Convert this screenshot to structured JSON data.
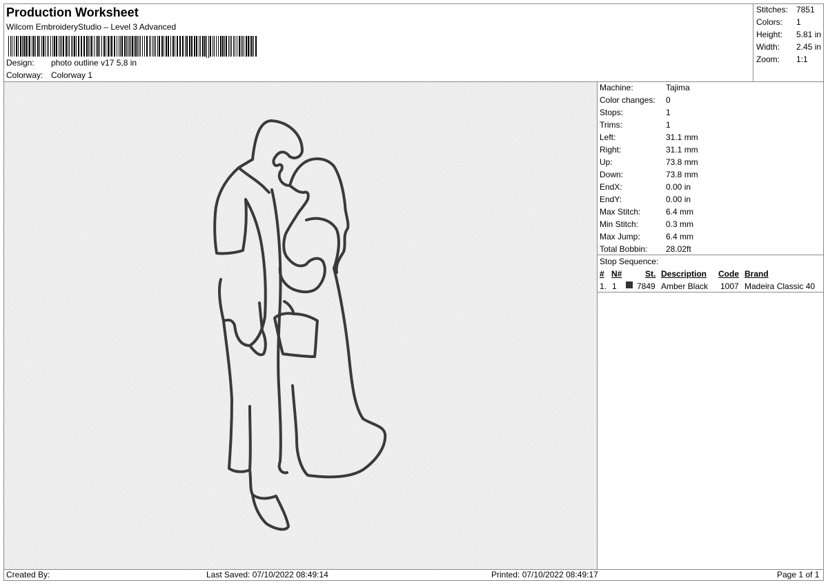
{
  "header": {
    "title": "Production Worksheet",
    "software": "Wilcom EmbroideryStudio – Level 3 Advanced",
    "design_label": "Design:",
    "design_value": "photo outline v17 5,8 in",
    "colorway_label": "Colorway:",
    "colorway_value": "Colorway 1"
  },
  "summary": [
    {
      "label": "Stitches:",
      "value": "7851"
    },
    {
      "label": "Colors:",
      "value": "1"
    },
    {
      "label": "Height:",
      "value": "5.81 in"
    },
    {
      "label": "Width:",
      "value": "2.45 in"
    },
    {
      "label": "Zoom:",
      "value": "1:1"
    }
  ],
  "properties": [
    {
      "label": "Machine:",
      "value": "Tajima"
    },
    {
      "label": "Color changes:",
      "value": "0"
    },
    {
      "label": "Stops:",
      "value": "1"
    },
    {
      "label": "Trims:",
      "value": "1"
    },
    {
      "label": "Left:",
      "value": "31.1 mm"
    },
    {
      "label": "Right:",
      "value": "31.1 mm"
    },
    {
      "label": "Up:",
      "value": "73.8 mm"
    },
    {
      "label": "Down:",
      "value": "73.8 mm"
    },
    {
      "label": "EndX:",
      "value": "0.00 in"
    },
    {
      "label": "EndY:",
      "value": "0.00 in"
    },
    {
      "label": "Max Stitch:",
      "value": "6.4 mm"
    },
    {
      "label": "Min Stitch:",
      "value": "0.3 mm"
    },
    {
      "label": "Max Jump:",
      "value": "6.4 mm"
    },
    {
      "label": "Total Bobbin:",
      "value": "28.02ft"
    }
  ],
  "stop_sequence": {
    "title": "Stop Sequence:",
    "headers": {
      "num": "#",
      "n": "N#",
      "st": "St.",
      "description": "Description",
      "code": "Code",
      "brand": "Brand"
    },
    "rows": [
      {
        "num": "1.",
        "n": "1",
        "color": "#333333",
        "st": "7849",
        "description": "Amber Black",
        "code": "1007",
        "brand": "Madeira Classic 40"
      }
    ]
  },
  "footer": {
    "created_by": "Created By:",
    "last_saved": "Last Saved: 07/10/2022 08:49:14",
    "printed": "Printed: 07/10/2022 08:49:17",
    "page": "Page 1 of 1"
  },
  "colors": {
    "thread": "#3a3a3a",
    "canvas": "#ebebeb",
    "border": "#8a8a8a"
  }
}
